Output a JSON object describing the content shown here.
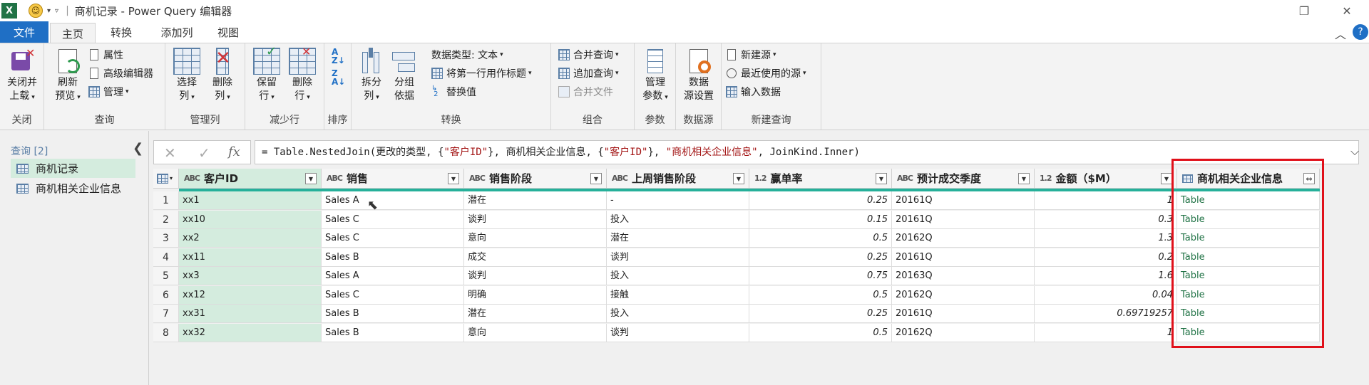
{
  "titlebar": {
    "app_logo": "X",
    "title": "商机记录 - Power Query 编辑器",
    "separator": "|",
    "restore_glyph": "❐",
    "close_glyph": "✕"
  },
  "tabs": {
    "file": "文件",
    "home": "主页",
    "transform": "转换",
    "add_column": "添加列",
    "view": "视图",
    "collapse_glyph": "︿",
    "help_glyph": "?"
  },
  "ribbon": {
    "close": {
      "label1": "关闭并",
      "label2": "上载",
      "group": "关闭"
    },
    "query": {
      "refresh1": "刷新",
      "refresh2": "预览",
      "properties": "属性",
      "advanced_editor": "高级编辑器",
      "manage": "管理",
      "group": "查询"
    },
    "manage_columns": {
      "choose1": "选择",
      "choose2": "列",
      "remove1": "删除",
      "remove2": "列",
      "group": "管理列"
    },
    "reduce_rows": {
      "keep1": "保留",
      "keep2": "行",
      "remove1": "删除",
      "remove2": "行",
      "group": "减少行"
    },
    "sort": {
      "group": "排序"
    },
    "transform": {
      "split1": "拆分",
      "split2": "列",
      "groupby1": "分组",
      "groupby2": "依据",
      "datatype": "数据类型: 文本",
      "first_row_header": "将第一行用作标题",
      "replace_values": "替换值",
      "group": "转换"
    },
    "combine": {
      "merge": "合并查询",
      "append": "追加查询",
      "combine_files": "合并文件",
      "group": "组合"
    },
    "parameters": {
      "label1": "管理",
      "label2": "参数",
      "group": "参数"
    },
    "datasource": {
      "label1": "数据",
      "label2": "源设置",
      "group": "数据源"
    },
    "new_query": {
      "new_source": "新建源",
      "recent_sources": "最近使用的源",
      "enter_data": "输入数据",
      "group": "新建查询"
    }
  },
  "queries_pane": {
    "title": "查询 [2]",
    "collapse_glyph": "❮",
    "items": [
      {
        "label": "商机记录",
        "selected": true
      },
      {
        "label": "商机相关企业信息",
        "selected": false
      }
    ]
  },
  "formula_bar": {
    "cancel_glyph": "✕",
    "commit_glyph": "✓",
    "fx_glyph": "fx",
    "expand_glyph": "⌵",
    "part1": "= Table.NestedJoin(更改的类型, {",
    "str1": "\"客户ID\"",
    "part2": "}, 商机相关企业信息, {",
    "str2": "\"客户ID\"",
    "part3": "}, ",
    "str3": "\"商机相关企业信息\"",
    "part4": ", JoinKind.Inner)"
  },
  "grid": {
    "columns": [
      {
        "type": "ABC",
        "name": "客户ID"
      },
      {
        "type": "ABC",
        "name": "销售"
      },
      {
        "type": "ABC",
        "name": "销售阶段"
      },
      {
        "type": "ABC",
        "name": "上周销售阶段"
      },
      {
        "type": "1.2",
        "name": "赢单率"
      },
      {
        "type": "ABC",
        "name": "预计成交季度"
      },
      {
        "type": "1.2",
        "name": "金额（$M）"
      },
      {
        "type": "table",
        "name": "商机相关企业信息"
      }
    ],
    "rows": [
      [
        "1",
        "xx1",
        "Sales A",
        "潜在",
        "-",
        "0.25",
        "20161Q",
        "1",
        "Table"
      ],
      [
        "2",
        "xx10",
        "Sales C",
        "谈判",
        "投入",
        "0.15",
        "20161Q",
        "0.3",
        "Table"
      ],
      [
        "3",
        "xx2",
        "Sales C",
        "意向",
        "潜在",
        "0.5",
        "20162Q",
        "1.3",
        "Table"
      ],
      [
        "4",
        "xx11",
        "Sales B",
        "成交",
        "谈判",
        "0.25",
        "20161Q",
        "0.2",
        "Table"
      ],
      [
        "5",
        "xx3",
        "Sales A",
        "谈判",
        "投入",
        "0.75",
        "20163Q",
        "1.6",
        "Table"
      ],
      [
        "6",
        "xx12",
        "Sales C",
        "明确",
        "接触",
        "0.5",
        "20162Q",
        "0.04",
        "Table"
      ],
      [
        "7",
        "xx31",
        "Sales B",
        "潜在",
        "投入",
        "0.25",
        "20161Q",
        "0.69719257",
        "Table"
      ],
      [
        "8",
        "xx32",
        "Sales B",
        "意向",
        "谈判",
        "0.5",
        "20162Q",
        "1",
        "Table"
      ]
    ]
  },
  "colors": {
    "accent": "#1f6fc5",
    "excel_green": "#217346",
    "highlight": "#e0101a",
    "quality_bar": "#26b09a"
  }
}
